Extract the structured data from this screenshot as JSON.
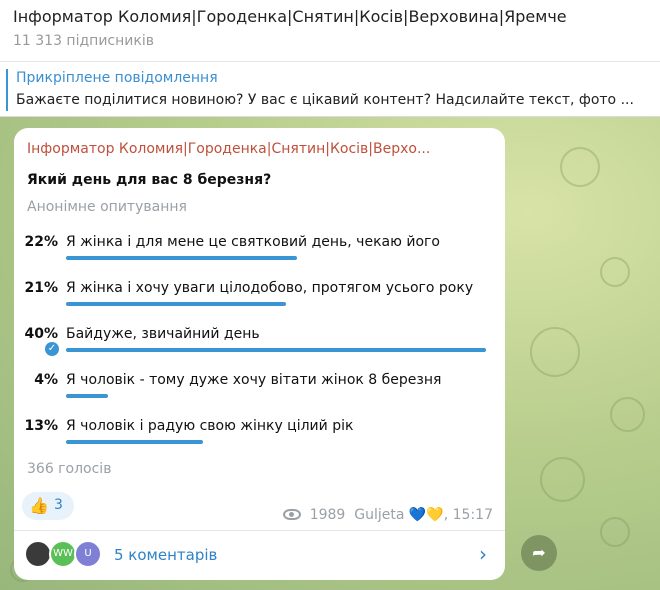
{
  "header": {
    "title": "Інформатор Коломия|Городенка|Снятин|Косів|Верховина|Яремче",
    "subscribers": "11 313 підписників"
  },
  "pinned": {
    "title": "Прикріплене повідомлення",
    "text": "Бажаєте поділитися новиною? У вас є цікавий контент? Надсилайте текст, фото ..."
  },
  "message": {
    "sender": "Інформатор Коломия|Городенка|Снятин|Косів|Верхо...",
    "question": "Який день для вас 8 березня?",
    "poll_type": "Анонімне опитування",
    "options": [
      {
        "percent": "22%",
        "text": "Я жінка і для мене це святковий день, чекаю його",
        "fraction": 0.22,
        "chosen": false
      },
      {
        "percent": "21%",
        "text": "Я жінка і хочу уваги цілодобово, протягом усього року",
        "fraction": 0.21,
        "chosen": false
      },
      {
        "percent": "40%",
        "text": "Байдуже, звичайний день",
        "fraction": 0.4,
        "chosen": true
      },
      {
        "percent": "4%",
        "text": "Я чоловік - тому дуже хочу вітати жінок 8 березня",
        "fraction": 0.04,
        "chosen": false
      },
      {
        "percent": "13%",
        "text": "Я чоловік і радую свою жінку цілий рік",
        "fraction": 0.13,
        "chosen": false
      }
    ],
    "votes": "366 голосів",
    "reaction": {
      "emoji": "👍",
      "count": "3"
    },
    "views": "1989",
    "signature": "Guljeta",
    "hearts": "💙💛",
    "time": ", 15:17",
    "comments": {
      "label": "5 коментарів",
      "avatars": [
        "",
        "WW",
        "U"
      ]
    }
  },
  "colors": {
    "accent": "#3a95d5",
    "sender": "#c0503c",
    "chat_bg": "#b7cd8c"
  }
}
